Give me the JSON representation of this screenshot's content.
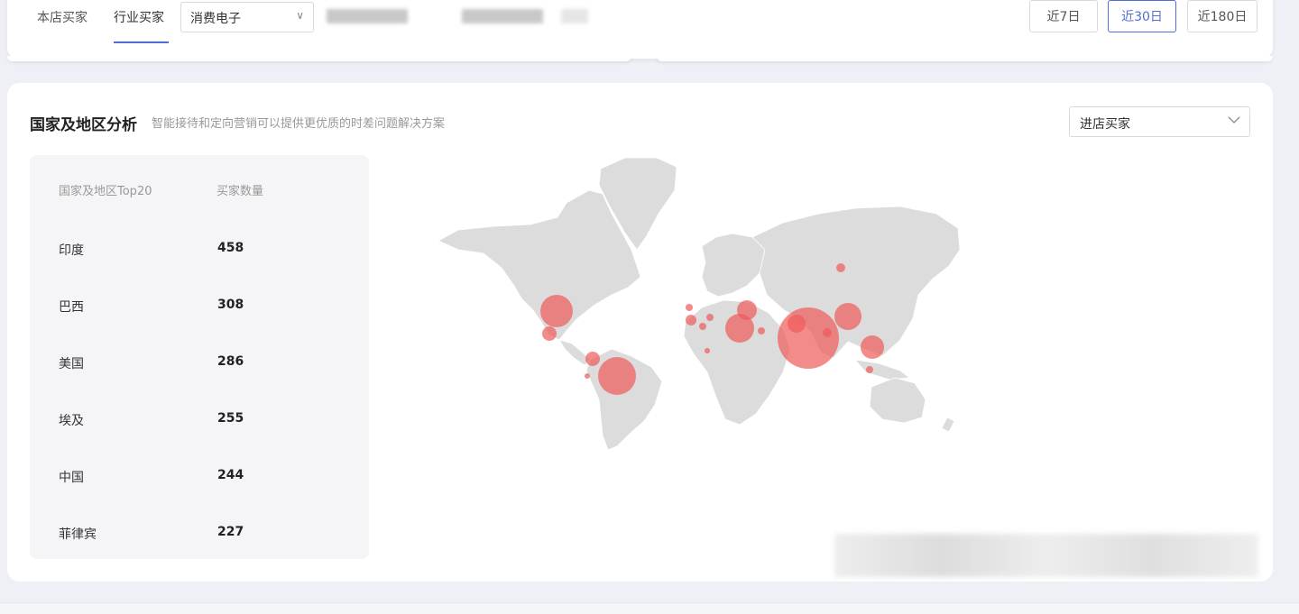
{
  "top_bar": {
    "tabs": [
      "本店买家",
      "行业买家"
    ],
    "category_select": "消费电子",
    "date_ranges": [
      "近7日",
      "近30日",
      "近180日"
    ],
    "active_range": "近30日",
    "accent_color": "#4f6fd6"
  },
  "region_analysis": {
    "title": "国家及地区分析",
    "subtitle": "智能接待和定向营销可以提供更优质的时差问题解决方案",
    "buyer_type_select": "进店买家",
    "table": {
      "col_country": "国家及地区Top20",
      "col_count": "买家数量",
      "rows": [
        {
          "country": "印度",
          "count": "458"
        },
        {
          "country": "巴西",
          "count": "308"
        },
        {
          "country": "美国",
          "count": "286"
        },
        {
          "country": "埃及",
          "count": "255"
        },
        {
          "country": "中国",
          "count": "244"
        },
        {
          "country": "菲律宾",
          "count": "227"
        }
      ]
    },
    "map": {
      "land_color": "#dcdcdc",
      "bubble_color": "#f05a5a"
    }
  }
}
